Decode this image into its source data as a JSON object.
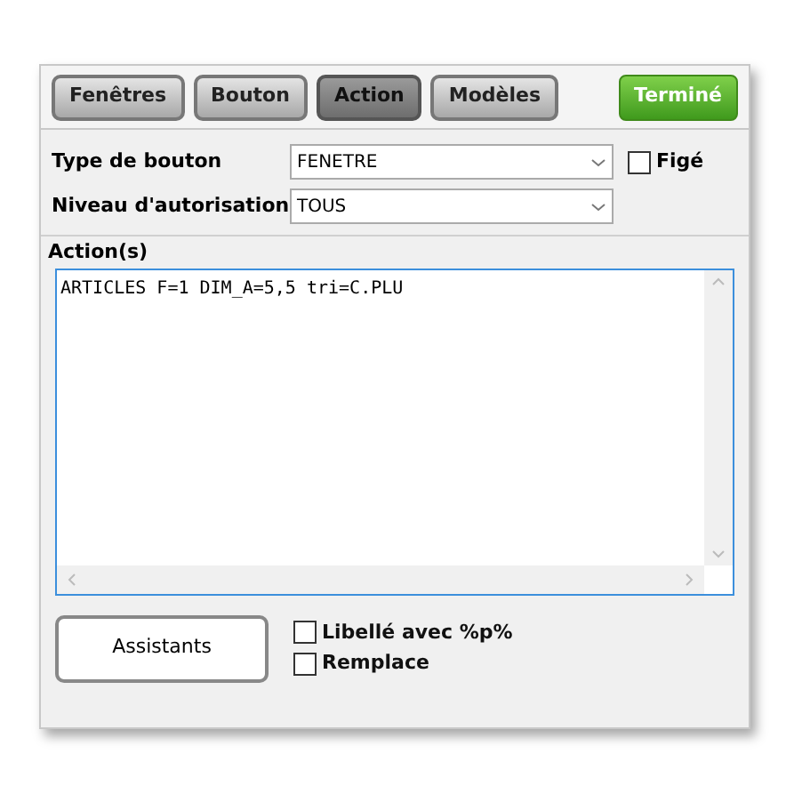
{
  "tabs": [
    {
      "label": "Fenêtres",
      "selected": false
    },
    {
      "label": "Bouton",
      "selected": false
    },
    {
      "label": "Action",
      "selected": true
    },
    {
      "label": "Modèles",
      "selected": false
    }
  ],
  "done_button": "Terminé",
  "fields": [
    {
      "label": "Type de bouton",
      "value": "FENETRE",
      "checkbox": {
        "label": "Figé",
        "checked": false
      }
    },
    {
      "label": "Niveau d'autorisation",
      "value": "TOUS"
    }
  ],
  "actions": {
    "label": "Action(s)",
    "value": "ARTICLES F=1 DIM_A=5,5 tri=C.PLU"
  },
  "assistants_button": "Assistants",
  "options": [
    {
      "label": "Libellé avec %p%",
      "checked": false
    },
    {
      "label": "Remplace",
      "checked": false
    }
  ]
}
